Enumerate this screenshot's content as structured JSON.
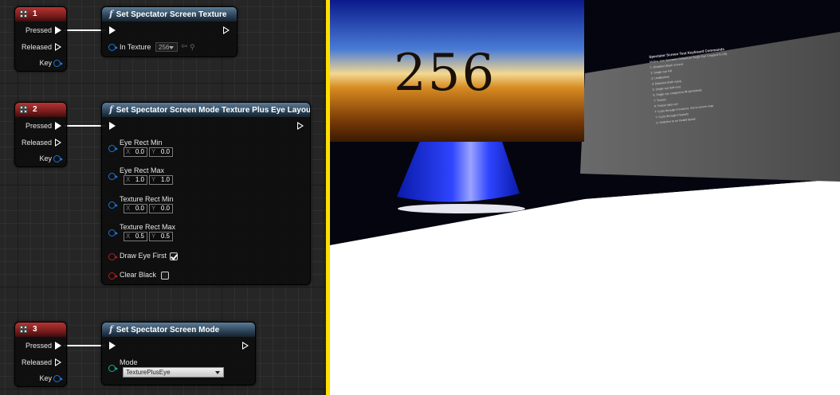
{
  "colors": {
    "divider": "#ffe000",
    "event_header": "#a82a2a",
    "function_header": "#3d586f",
    "grid": "#262626"
  },
  "nodes": {
    "event1": {
      "title": "1",
      "pins": [
        "Pressed",
        "Released",
        "Key"
      ]
    },
    "event2": {
      "title": "2",
      "pins": [
        "Pressed",
        "Released",
        "Key"
      ]
    },
    "event3": {
      "title": "3",
      "pins": [
        "Pressed",
        "Released",
        "Key"
      ]
    },
    "fn1": {
      "title": "Set Spectator Screen Texture",
      "param_label": "In Texture",
      "param_value": "256"
    },
    "fn2": {
      "title": "Set Spectator Screen Mode Texture Plus Eye Layout",
      "eye_rect_min": {
        "label": "Eye Rect Min",
        "x": "0.0",
        "y": "0.0"
      },
      "eye_rect_max": {
        "label": "Eye Rect Max",
        "x": "1.0",
        "y": "1.0"
      },
      "texture_rect_min": {
        "label": "Texture Rect Min",
        "x": "0.0",
        "y": "0.0"
      },
      "texture_rect_max": {
        "label": "Texture Rect Max",
        "x": "0.5",
        "y": "0.5"
      },
      "draw_eye_first": {
        "label": "Draw Eye First",
        "checked": true
      },
      "clear_black": {
        "label": "Clear Black",
        "checked": false
      }
    },
    "fn3": {
      "title": "Set Spectator Screen Mode",
      "param_label": "Mode",
      "param_value": "TexturePlusEye"
    }
  },
  "axis": {
    "x": "X",
    "y": "Y"
  },
  "icons": {
    "function": "function-icon",
    "event": "keyboard-event-icon",
    "exec": "exec-pin-icon",
    "data": "data-pin-icon"
  },
  "viewport": {
    "texture_label": "256",
    "panel_lines": [
      "Spectator Screen Test Keyboard Commands",
      "Modes: Use Spectator Default (or Single Eye Cropped To Fill)",
      "1: Disabled (black screen)",
      "2: Single eye left",
      "3: Undistorted",
      "4: Distorted (both eyes)",
      "5: Single eye (left eye)",
      "6: Single eye cropped to fill (stretched)",
      "7: Texture",
      "8: Texture plus eye",
      "",
      "T: Cycle through 3 textures. Set to screen map",
      "Y: Cycle through 3 layouts",
      "U: Switches to an invalid layout"
    ]
  }
}
